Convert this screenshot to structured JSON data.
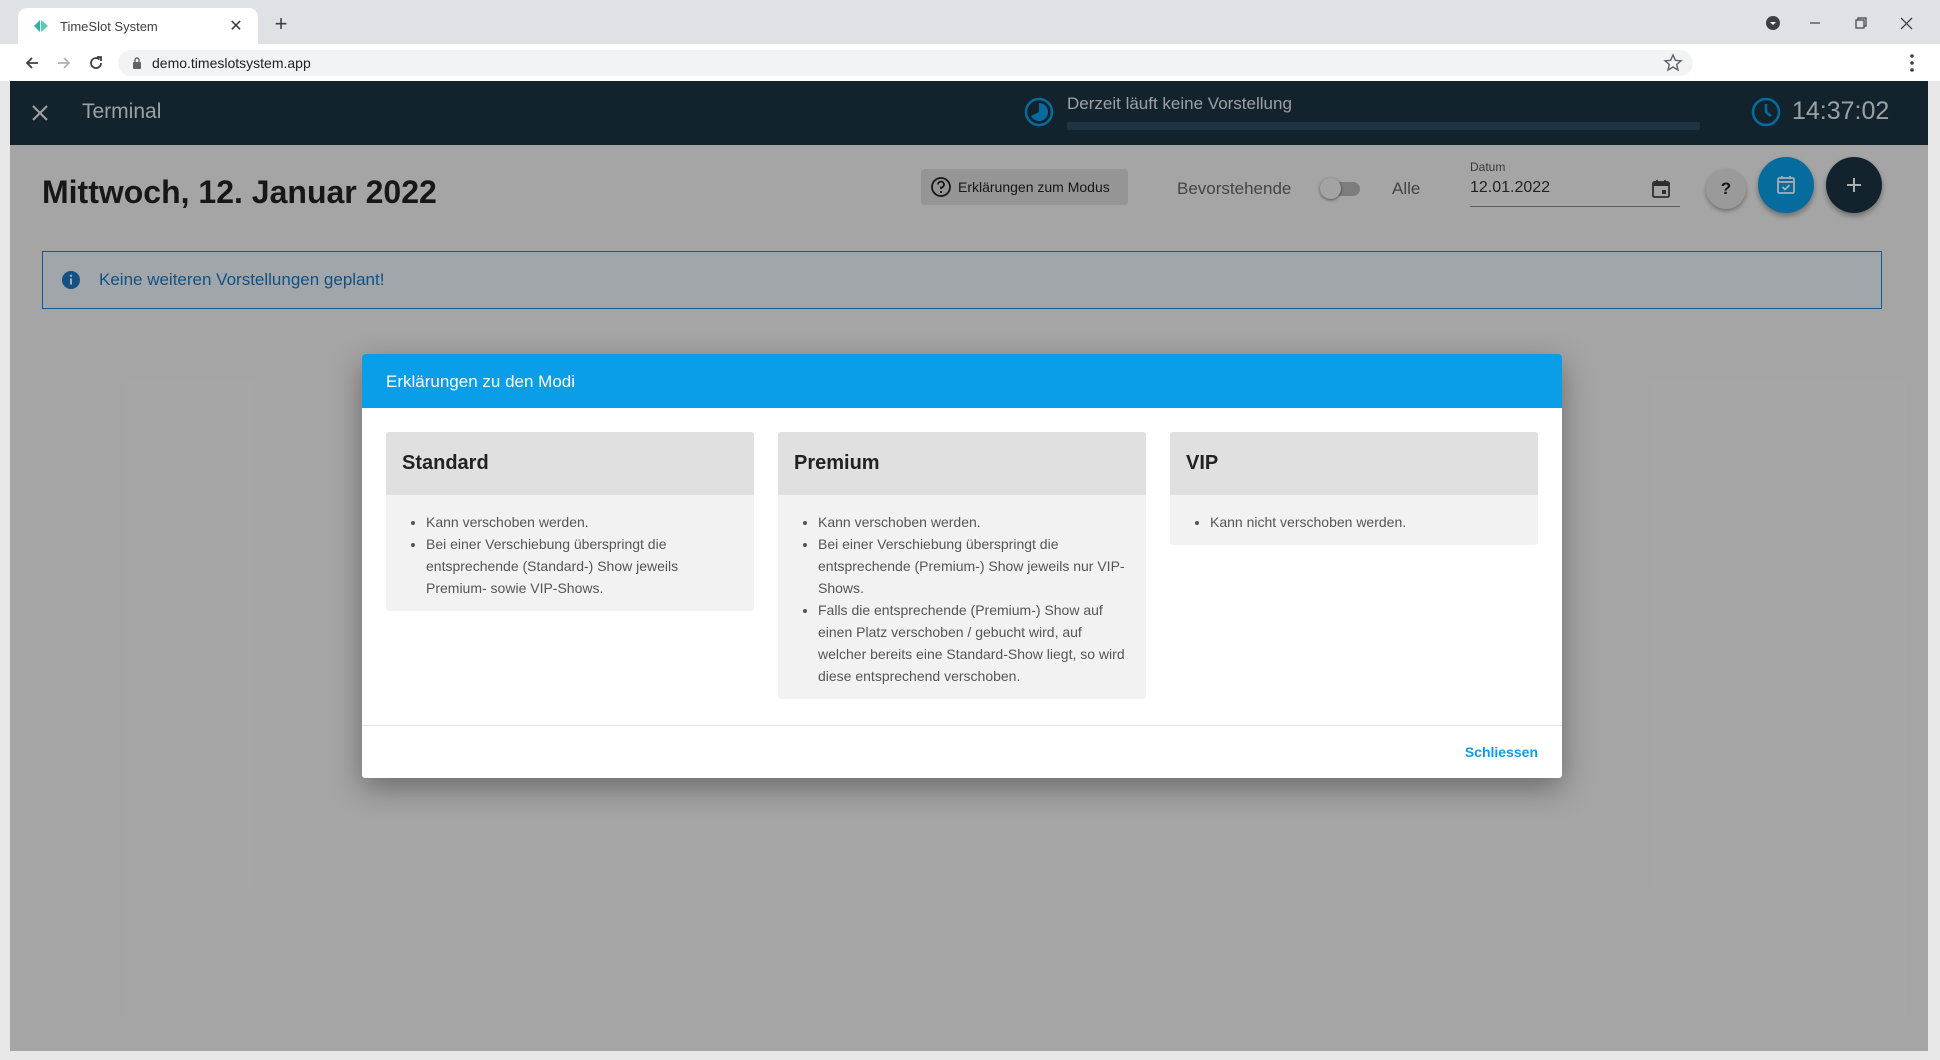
{
  "browser": {
    "tab_title": "TimeSlot System",
    "url": "demo.timeslotsystem.app"
  },
  "appbar": {
    "title": "Terminal",
    "now_playing": "Derzeit läuft keine Vorstellung",
    "clock": "14:37:02"
  },
  "page": {
    "title": "Mittwoch, 12. Januar 2022",
    "mode_button": "Erklärungen zum Modus",
    "filter_upcoming": "Bevorstehende",
    "filter_all": "Alle",
    "filter_all_selected": false,
    "date_label": "Datum",
    "date_value": "12.01.2022",
    "help_button": "?",
    "alert": "Keine weiteren Vorstellungen geplant!"
  },
  "dialog": {
    "title": "Erklärungen zu den Modi",
    "cards": [
      {
        "title": "Standard",
        "items": [
          "Kann verschoben werden.",
          "Bei einer Verschiebung überspringt die entsprechende (Standard-) Show jeweils Premium- sowie VIP-Shows."
        ]
      },
      {
        "title": "Premium",
        "items": [
          "Kann verschoben werden.",
          "Bei einer Verschiebung überspringt die entsprechende (Premium-) Show jeweils nur VIP-Shows.",
          "Falls die entsprechende (Premium-) Show auf einen Platz verschoben / gebucht wird, auf welcher bereits eine Standard-Show liegt, so wird diese entsprechend verschoben."
        ]
      },
      {
        "title": "VIP",
        "items": [
          "Kann nicht verschoben werden."
        ]
      }
    ],
    "close_label": "Schliessen"
  },
  "colors": {
    "appbar": "#1d3445",
    "accent": "#0a9ee8",
    "info": "#1b88d8"
  }
}
